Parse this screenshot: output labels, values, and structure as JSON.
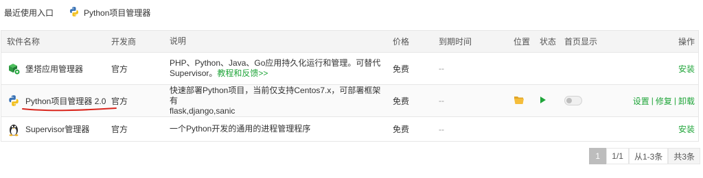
{
  "recent": {
    "label": "最近使用入口",
    "entry_label": "Python项目管理器",
    "entry_icon": "python-icon"
  },
  "table": {
    "headers": {
      "name": "软件名称",
      "developer": "开发商",
      "description": "说明",
      "price": "价格",
      "expire": "到期时间",
      "position": "位置",
      "state": "状态",
      "home": "首页显示",
      "ops": "操作"
    },
    "rows": [
      {
        "name": "堡塔应用管理器",
        "icon": "bt-app-manager-icon",
        "developer": "官方",
        "desc_line1": "PHP、Python、Java、Go应用持久化运行和管理。可替代",
        "desc_line2": "Supervisor。",
        "desc_link": "教程和反馈>>",
        "price": "免费",
        "expire": "--",
        "op_install": "安装"
      },
      {
        "name": "Python项目管理器 2.0",
        "icon": "python-icon",
        "developer": "官方",
        "desc_line1": "快速部署Python项目，当前仅支持Centos7.x，可部署框架有",
        "desc_line2": "flask,django,sanic",
        "price": "免费",
        "expire": "--",
        "position_icon": "folder-icon",
        "state_icon": "play-icon",
        "home_toggle": false,
        "op_settings": "设置",
        "op_sep": "|",
        "op_repair": "修复",
        "op_uninstall": "卸载"
      },
      {
        "name": "Supervisor管理器",
        "icon": "linux-penguin-icon",
        "developer": "官方",
        "desc_line1": "一个Python开发的通用的进程管理程序",
        "price": "免费",
        "expire": "--",
        "op_install": "安装"
      }
    ]
  },
  "pagination": {
    "current": "1",
    "pages": "1/1",
    "range": "从1-3条",
    "total": "共3条"
  },
  "colors": {
    "accent": "#20a53a",
    "annotation": "#d9251c",
    "header_bg": "#f4f4f4",
    "border": "#e6e6e6"
  }
}
